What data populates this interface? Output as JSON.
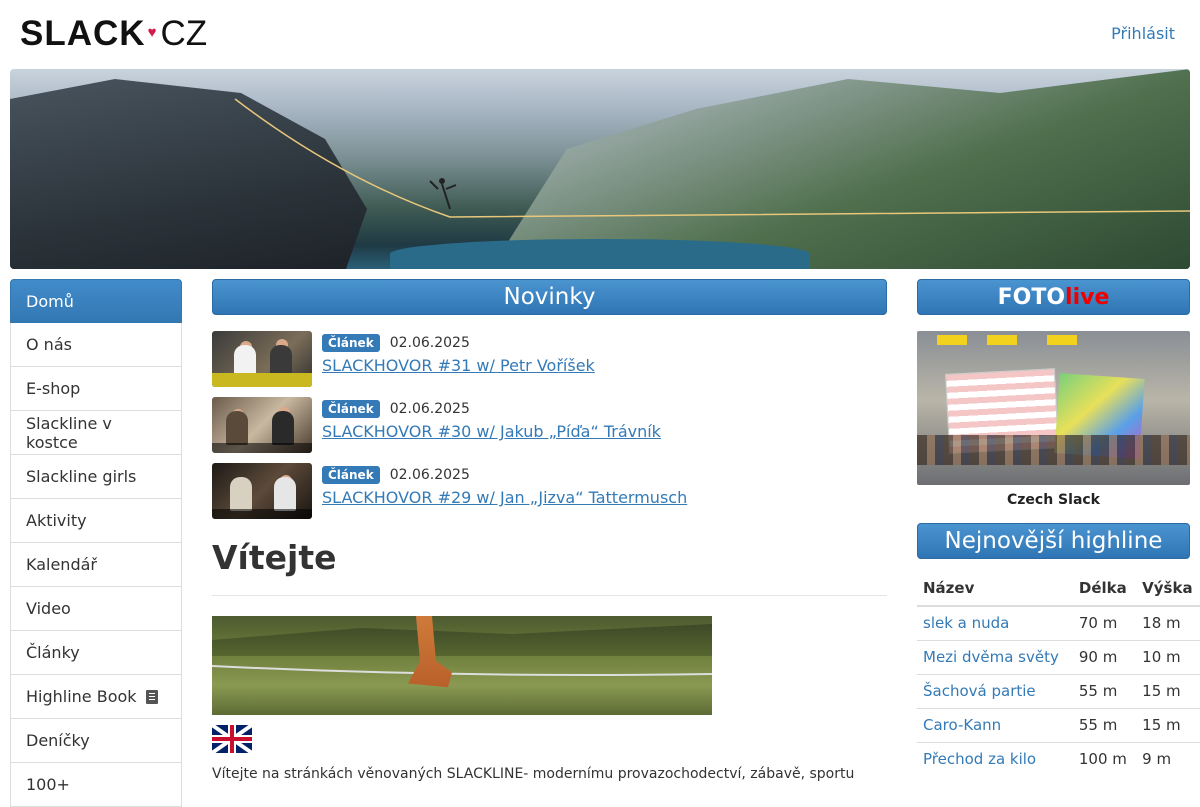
{
  "header": {
    "logo_main": "SLACK",
    "logo_heart": "♥",
    "logo_suffix": "CZ",
    "login": "Přihlásit"
  },
  "sidebar": {
    "items": [
      {
        "label": "Domů",
        "active": true
      },
      {
        "label": "O nás"
      },
      {
        "label": "E-shop"
      },
      {
        "label": "Slackline v kostce"
      },
      {
        "label": "Slackline girls"
      },
      {
        "label": "Aktivity"
      },
      {
        "label": "Kalendář"
      },
      {
        "label": "Video"
      },
      {
        "label": "Články"
      },
      {
        "label": "Highline Book",
        "icon": "book-icon"
      },
      {
        "label": "Deníčky"
      },
      {
        "label": "100+"
      }
    ]
  },
  "news": {
    "title": "Novinky",
    "items": [
      {
        "badge": "Článek",
        "date": "02.06.2025",
        "title": "SLACKHOVOR #31 w/ Petr Voříšek",
        "thumb_caption": "Petr Voříšek"
      },
      {
        "badge": "Článek",
        "date": "02.06.2025",
        "title": "SLACKHOVOR #30 w/ Jakub „Píďa“ Trávník",
        "thumb_caption": "w/ Jakub „Píďa“ Trávník"
      },
      {
        "badge": "Článek",
        "date": "02.06.2025",
        "title": "SLACKHOVOR #29 w/ Jan „Jizva“ Tattermusch",
        "thumb_caption": "w/ Jan „Jizva“ Tattermusch"
      }
    ]
  },
  "welcome": {
    "heading": "Vítejte",
    "intro": "Vítejte na stránkách věnovaných SLACKLINE- modernímu provazochodectví, zábavě, sportu"
  },
  "foto": {
    "title_a": "FOTO",
    "title_b": "live",
    "caption": "Czech Slack"
  },
  "highlines": {
    "title": "Nejnovější highline",
    "columns": [
      "Název",
      "Délka",
      "Výška"
    ],
    "rows": [
      {
        "name": "slek a nuda",
        "length": "70 m",
        "height": "18 m"
      },
      {
        "name": "Mezi dvěma světy",
        "length": "90 m",
        "height": "10 m"
      },
      {
        "name": "Šachová partie",
        "length": "55 m",
        "height": "15 m"
      },
      {
        "name": "Caro-Kann",
        "length": "55 m",
        "height": "15 m"
      },
      {
        "name": "Přechod za kilo",
        "length": "100 m",
        "height": "9 m"
      }
    ]
  },
  "colors": {
    "accent": "#337ab7",
    "live": "#e00000"
  }
}
